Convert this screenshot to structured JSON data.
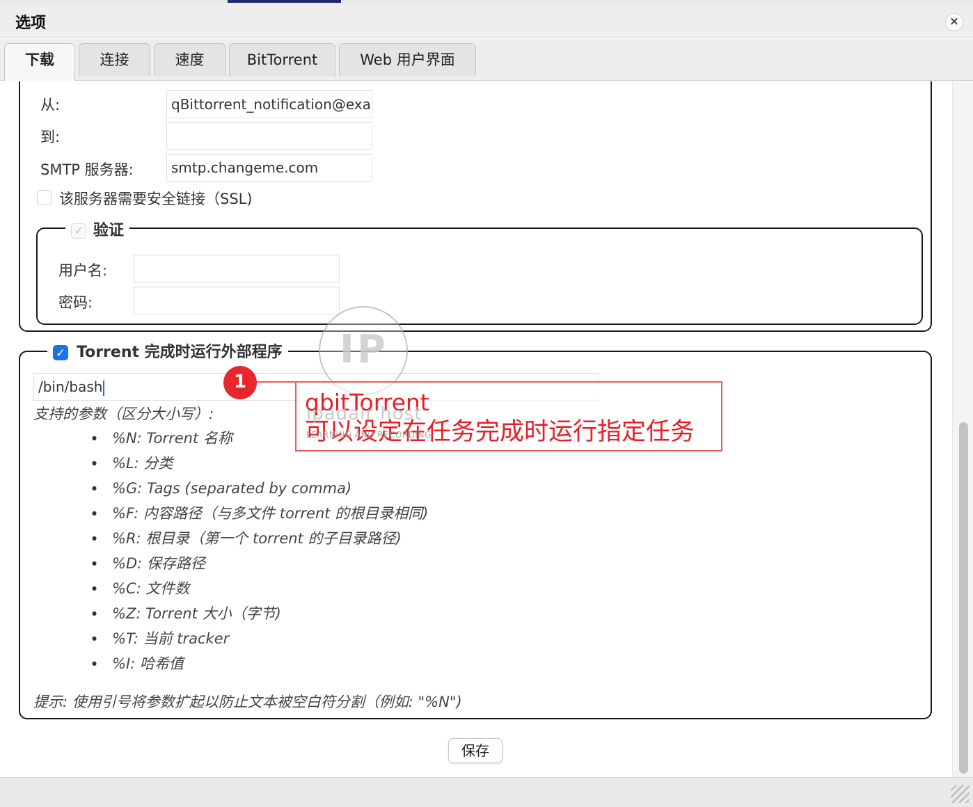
{
  "window": {
    "title": "选项",
    "close_label": "×"
  },
  "tabs": [
    {
      "label": "下载",
      "active": true
    },
    {
      "label": "连接",
      "active": false
    },
    {
      "label": "速度",
      "active": false
    },
    {
      "label": "BitTorrent",
      "active": false
    },
    {
      "label": "Web 用户界面",
      "active": false
    }
  ],
  "email": {
    "from_label": "从:",
    "from_value": "qBittorrent_notification@example.com",
    "to_label": "到:",
    "to_value": "",
    "smtp_label": "SMTP 服务器:",
    "smtp_value": "smtp.changeme.com",
    "ssl_label": "该服务器需要安全链接（SSL)",
    "ssl_checked": false
  },
  "auth": {
    "legend": "验证",
    "checked": true,
    "username_label": "用户名:",
    "username_value": "",
    "password_label": "密码:",
    "password_value": ""
  },
  "run_program": {
    "legend": "Torrent 完成时运行外部程序",
    "checked": true,
    "command_value": "/bin/bash",
    "params_title": "支持的参数（区分大小写）:",
    "params": [
      "%N: Torrent 名称",
      "%L: 分类",
      "%G: Tags (separated by comma)",
      "%F: 内容路径（与多文件 torrent 的根目录相同)",
      "%R: 根目录（第一个 torrent 的子目录路径)",
      "%D: 保存路径",
      "%C: 文件数",
      "%Z: Torrent 大小（字节)",
      "%T: 当前 tracker",
      "%I: 哈希值"
    ],
    "hint": "提示: 使用引号将参数扩起以防止文本被空白符分割（例如: \"%N\")"
  },
  "save_label": "保存",
  "annotation": {
    "badge": "1",
    "line1": "qbitTorrent",
    "line2": "可以设定在任务完成时运行指定任务",
    "color": "#e81e24"
  },
  "watermark": {
    "logo": "IP",
    "name": "ipadair host",
    "sub": "LEARNING AND RECORDING"
  },
  "colors": {
    "accent": "#1a73e8",
    "annotation": "#e81e24"
  }
}
